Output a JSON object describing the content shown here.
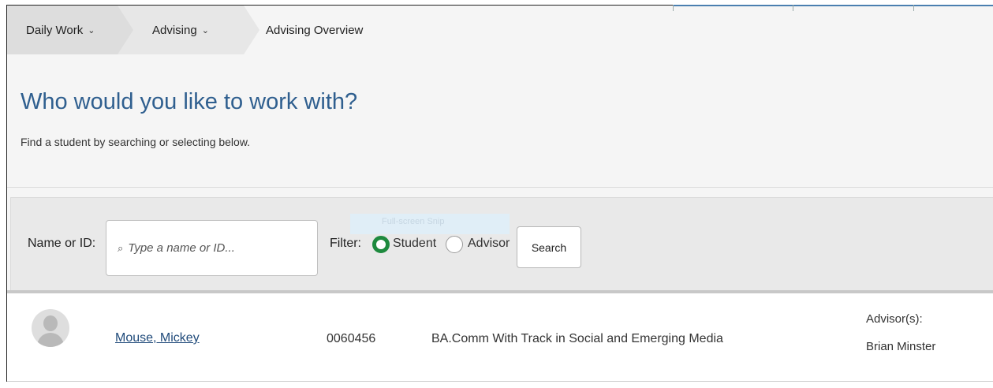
{
  "breadcrumb": {
    "item1": "Daily Work",
    "item2": "Advising",
    "current": "Advising Overview",
    "chevron": "⌄"
  },
  "header": {
    "title": "Who would you like to work with?",
    "subtitle": "Find a student by searching or selecting below."
  },
  "search": {
    "label": "Name or ID:",
    "placeholder": "Type a name or ID...",
    "value": "",
    "icon": "search-icon",
    "faded_hint": "Full-screen Snip",
    "filter_label": "Filter:",
    "options": [
      "Student",
      "Advisor"
    ],
    "selected": "Student",
    "button_label": "Search"
  },
  "results": [
    {
      "name": "Mouse, Mickey",
      "id": "0060456",
      "program": "BA.Comm With Track in Social and Emerging Media",
      "advisor_label": "Advisor(s):",
      "advisor": "Brian Minster"
    }
  ],
  "colors": {
    "title": "#2f5f8f",
    "link": "#1f4a7a",
    "radio_selected": "#1e8a3e",
    "panel": "#e9e9e9"
  }
}
